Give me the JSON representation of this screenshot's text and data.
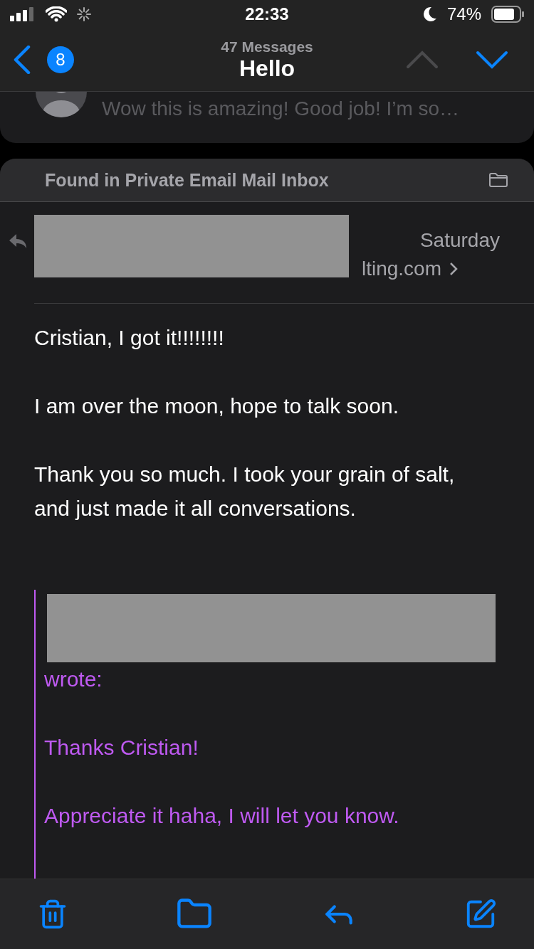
{
  "status_bar": {
    "time": "22:33",
    "battery": "74%"
  },
  "nav": {
    "subtitle": "47 Messages",
    "title": "Hello",
    "unread_badge": "8",
    "previous_disabled": true,
    "next_disabled": false
  },
  "previous_message": {
    "preview": "Wow this is amazing! Good job! I’m so…"
  },
  "message": {
    "found_in": "Found in Private Email Mail Inbox",
    "date": "Saturday",
    "sender_address": "lting.com",
    "body": [
      "Cristian, I got it!!!!!!!!",
      "I am over the moon, hope to talk soon.",
      "Thank you so much. I took your grain of salt, and just made it all conversations."
    ],
    "quote": {
      "attribution": "wrote:",
      "paragraphs": [
        "Thanks Cristian!",
        "Appreciate it haha, I will let you know."
      ]
    }
  }
}
